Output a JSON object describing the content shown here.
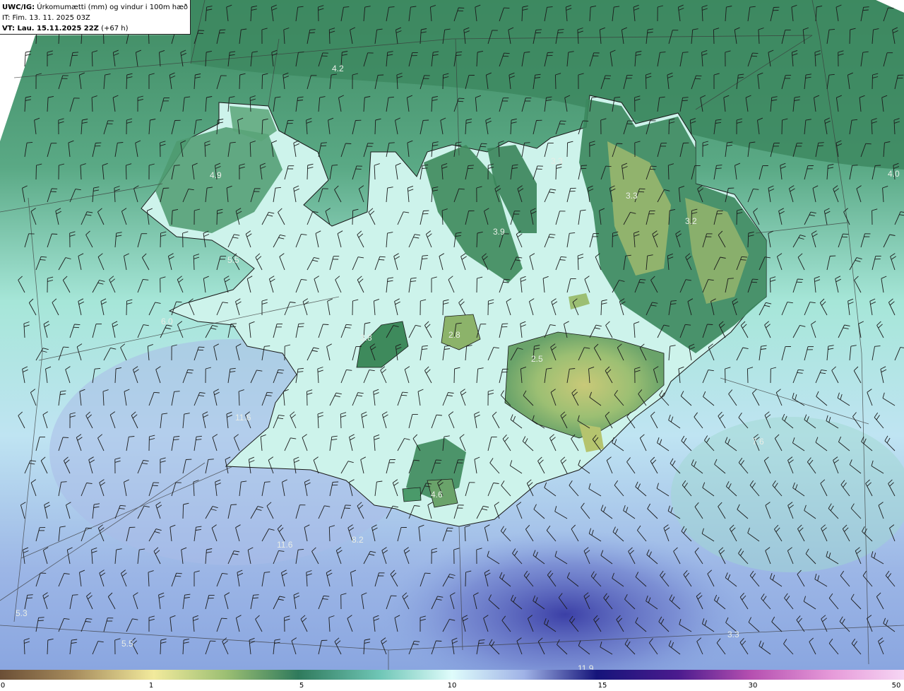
{
  "header": {
    "model": "UWC/IG:",
    "title": " Úrkomumætti (mm) og vindur i 100m hæð",
    "issue_time": "IT: Fim. 13. 11. 2025 03Z",
    "valid_time_label": "VT:",
    "valid_time": " Lau. 15.11.2025 22Z",
    "lead": " (+67 h)"
  },
  "map_labels": [
    "4.2",
    "4.9",
    "3.3",
    "3.3",
    "4.0",
    "3.2",
    "3.9",
    "5.5",
    "6.0",
    "3.8",
    "2.8",
    "2.5",
    "11.6",
    "7.6",
    "4.6",
    "11.6",
    "8.2",
    "5.3",
    "3.3",
    "5.5",
    "11.9"
  ],
  "colorbar": {
    "ticks": [
      "0",
      "1",
      "5",
      "10",
      "15",
      "30",
      "50"
    ],
    "colors": [
      "#6b4f36",
      "#c5b36c",
      "#f2ea9c",
      "#9cbf73",
      "#3a8a5a",
      "#2f7a5c",
      "#4fa79a",
      "#9fe3da",
      "#dffcfb",
      "#b9d8f4",
      "#8f9bd6",
      "#3b3fa6",
      "#15147a",
      "#4b1b8e",
      "#b54fb0",
      "#e69ad9",
      "#f6d6f4"
    ]
  },
  "colors": {
    "land_high": "#b5c46e",
    "land_mid": "#3e8a5c",
    "sea_low": "#d6f7f1",
    "sea_blue": "#8fa8e2",
    "sea_deep": "#4a4fb4"
  }
}
